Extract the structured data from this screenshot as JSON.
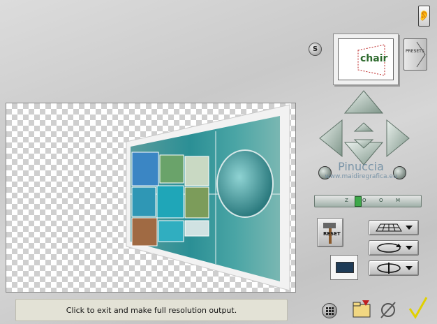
{
  "status": {
    "text": "Click to exit and make full resolution output."
  },
  "presets": {
    "label": "PRESETS"
  },
  "thumbnail": {
    "logo_text": "chair"
  },
  "s_button": {
    "label": "S"
  },
  "watermark": {
    "name": "Pinuccia",
    "url": "www.maidiregrafica.eu"
  },
  "zoom": {
    "label_letters": [
      "Z",
      "O",
      "O",
      "M"
    ]
  },
  "reset": {
    "label": "RESET"
  },
  "icons": {
    "ear": "ear-icon",
    "grid": "grid-icon",
    "folder": "folder-icon",
    "cancel": "cancel-icon",
    "ok": "checkmark-icon",
    "perspective": "perspective-grid-icon",
    "rotate": "rotate-icon",
    "flip": "flip-icon"
  },
  "colors": {
    "accent_teal": "#2aa6a8",
    "checkmark_yellow": "#e0d000"
  }
}
